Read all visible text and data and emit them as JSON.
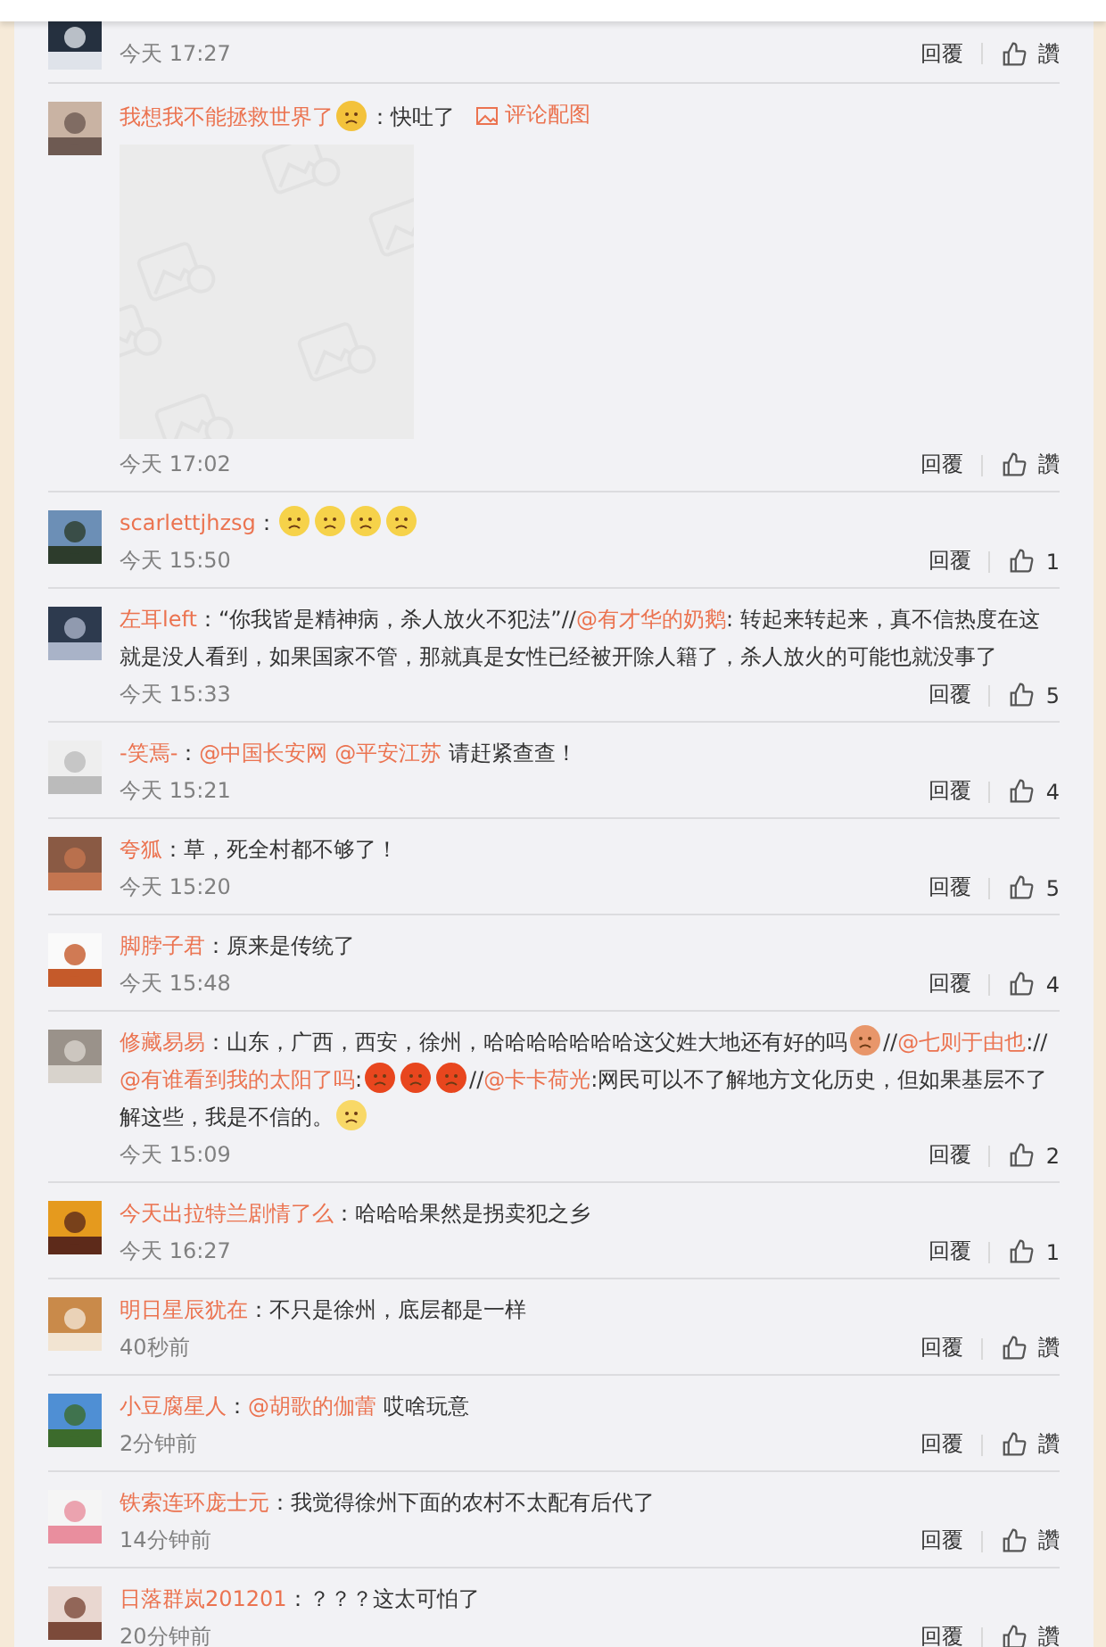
{
  "comments": [
    {
      "time": "今天 17:27",
      "reply": "回覆",
      "likes": "讚"
    },
    {
      "segments": [
        {
          "kind": "name",
          "text": "我想我不能拯救世界了"
        },
        {
          "kind": "emoji",
          "color": "#f3c23b"
        },
        {
          "kind": "text",
          "text": "：快吐了"
        },
        {
          "kind": "link",
          "text": "评论配图"
        }
      ],
      "time": "今天 17:02",
      "reply": "回覆",
      "likes": "讚",
      "attachment": true
    },
    {
      "segments": [
        {
          "kind": "name",
          "text": "scarlettjhzsg"
        },
        {
          "kind": "text",
          "text": "："
        },
        {
          "kind": "emoji",
          "color": "#f6d24a"
        },
        {
          "kind": "emoji",
          "color": "#f6d24a"
        },
        {
          "kind": "emoji",
          "color": "#f6d24a"
        },
        {
          "kind": "emoji",
          "color": "#f6d24a"
        }
      ],
      "time": "今天 15:50",
      "reply": "回覆",
      "likes": "1"
    },
    {
      "segments": [
        {
          "kind": "name",
          "text": "左耳left"
        },
        {
          "kind": "text",
          "text": "：“你我皆是精神病，杀人放火不犯法”//"
        },
        {
          "kind": "mention",
          "text": "@有才华的奶鹅"
        },
        {
          "kind": "text",
          "text": ": 转起来转起来，真不信热度在这就是没人看到，如果国家不管，那就真是女性已经被开除人籍了，杀人放火的可能也就没事了"
        }
      ],
      "time": "今天 15:33",
      "reply": "回覆",
      "likes": "5"
    },
    {
      "segments": [
        {
          "kind": "name",
          "text": "-笑焉-"
        },
        {
          "kind": "text",
          "text": "："
        },
        {
          "kind": "mention",
          "text": "@中国长安网"
        },
        {
          "kind": "mention",
          "text": "@平安江苏"
        },
        {
          "kind": "text",
          "text": " 请赶紧查查！"
        }
      ],
      "time": "今天 15:21",
      "reply": "回覆",
      "likes": "4"
    },
    {
      "segments": [
        {
          "kind": "name",
          "text": "夸狐"
        },
        {
          "kind": "text",
          "text": "：草，死全村都不够了！"
        }
      ],
      "time": "今天 15:20",
      "reply": "回覆",
      "likes": "5"
    },
    {
      "segments": [
        {
          "kind": "name",
          "text": "脚脖子君"
        },
        {
          "kind": "text",
          "text": "：原来是传统了"
        }
      ],
      "time": "今天 15:48",
      "reply": "回覆",
      "likes": "4"
    },
    {
      "segments": [
        {
          "kind": "name",
          "text": "修藏易易"
        },
        {
          "kind": "text",
          "text": "：山东，广西，西安，徐州，哈哈哈哈哈哈哈这父姓大地还有好的吗"
        },
        {
          "kind": "emoji",
          "color": "#e8966a"
        },
        {
          "kind": "text",
          "text": "//"
        },
        {
          "kind": "mention",
          "text": "@七则于由也"
        },
        {
          "kind": "text",
          "text": "://"
        },
        {
          "kind": "mention",
          "text": "@有谁看到我的太阳了吗"
        },
        {
          "kind": "text",
          "text": ":"
        },
        {
          "kind": "emoji",
          "color": "#e8461e"
        },
        {
          "kind": "emoji",
          "color": "#e8461e"
        },
        {
          "kind": "emoji",
          "color": "#e8461e"
        },
        {
          "kind": "text",
          "text": "//"
        },
        {
          "kind": "mention",
          "text": "@卡卡荷光"
        },
        {
          "kind": "text",
          "text": ":网民可以不了解地方文化历史，但如果基层不了解这些，我是不信的。"
        },
        {
          "kind": "emoji",
          "color": "#f8d867"
        }
      ],
      "time": "今天 15:09",
      "reply": "回覆",
      "likes": "2"
    },
    {
      "segments": [
        {
          "kind": "name",
          "text": "今天出拉特兰剧情了么"
        },
        {
          "kind": "text",
          "text": "：哈哈哈果然是拐卖犯之乡"
        }
      ],
      "time": "今天 16:27",
      "reply": "回覆",
      "likes": "1"
    },
    {
      "segments": [
        {
          "kind": "name",
          "text": "明日星辰犹在"
        },
        {
          "kind": "text",
          "text": "：不只是徐州，底层都是一样"
        }
      ],
      "time": "40秒前",
      "reply": "回覆",
      "likes": "讚"
    },
    {
      "segments": [
        {
          "kind": "name",
          "text": "小豆腐星人"
        },
        {
          "kind": "text",
          "text": "："
        },
        {
          "kind": "mention",
          "text": "@胡歌的伽蕾"
        },
        {
          "kind": "text",
          "text": " 哎啥玩意"
        }
      ],
      "time": "2分钟前",
      "reply": "回覆",
      "likes": "讚"
    },
    {
      "segments": [
        {
          "kind": "name",
          "text": "铁索连环庞士元"
        },
        {
          "kind": "text",
          "text": "：我觉得徐州下面的农村不太配有后代了"
        }
      ],
      "time": "14分钟前",
      "reply": "回覆",
      "likes": "讚"
    },
    {
      "segments": [
        {
          "kind": "name",
          "text": "日落群岚201201"
        },
        {
          "kind": "text",
          "text": "：？？？这太可怕了"
        }
      ],
      "time": "20分钟前",
      "reply": "回覆",
      "likes": "讚"
    }
  ]
}
